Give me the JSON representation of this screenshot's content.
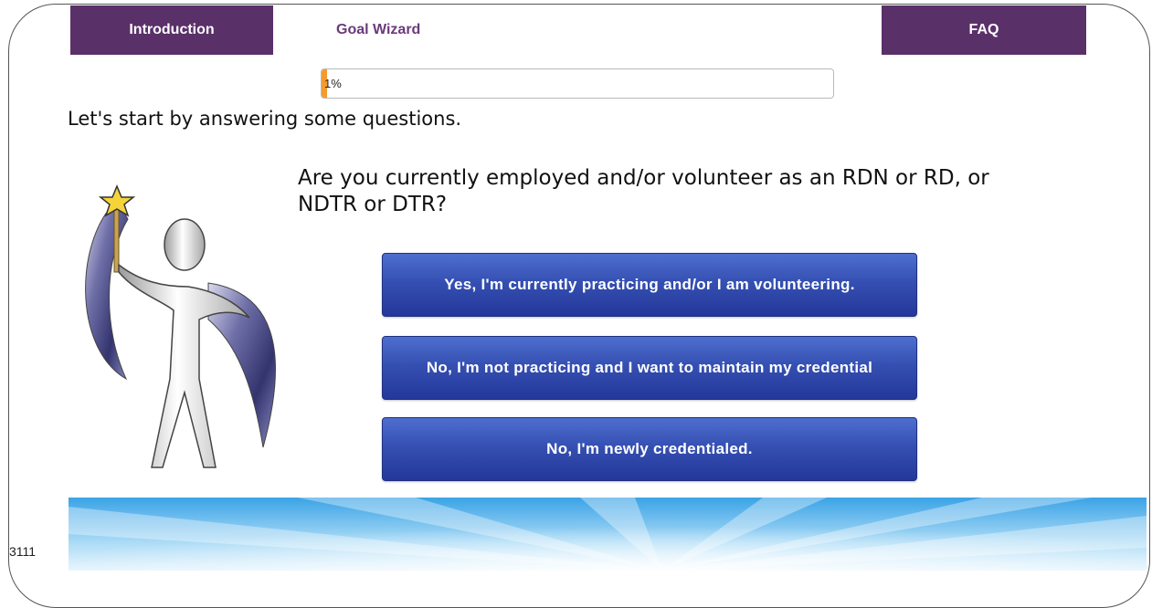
{
  "nav": {
    "tabs": [
      {
        "label": "Introduction"
      },
      {
        "label": "Goal Wizard"
      },
      {
        "label": "FAQ"
      }
    ],
    "active_tab": "Goal Wizard"
  },
  "progress": {
    "percent": 1,
    "label": "1%",
    "fill_color": "#f59a2f"
  },
  "main": {
    "lead_text": "Let's start by answering some questions.",
    "question": "Are you currently employed and/or volunteer as an RDN or RD, or NDTR or DTR?",
    "answers": [
      {
        "label": "Yes, I'm currently practicing and/or I am volunteering."
      },
      {
        "label": "No, I'm not practicing and I want to maintain my credential"
      },
      {
        "label": "No, I'm newly credentialed."
      }
    ]
  },
  "footer": {
    "code": "3111"
  },
  "colors": {
    "tab_purple": "#5a3069",
    "button_blue": "#3550b2",
    "banner_blue": "#5bb4ea"
  },
  "icons": {
    "wizard": "wizard-figure-with-star-wand-icon"
  }
}
